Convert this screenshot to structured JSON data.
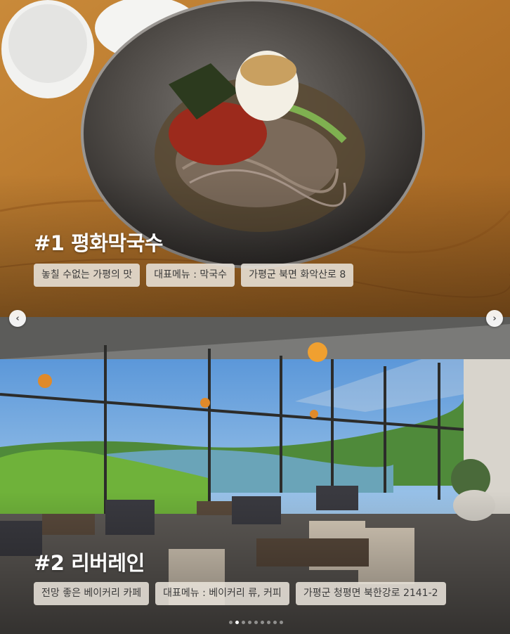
{
  "cards": [
    {
      "title": "#1 평화막국수",
      "tags": [
        "놓칠 수없는 가평의 맛",
        "대표메뉴 : 막국수",
        "가평군 북면 화악산로 8"
      ],
      "image_icon": "buckwheat-noodle-photo"
    },
    {
      "title": "#2 리버레인",
      "tags": [
        "전망 좋은 베이커리 카페",
        "대표메뉴 : 베이커리 류, 커피",
        "가평군 청평면 북한강로 2141-2"
      ],
      "image_icon": "river-view-cafe-photo"
    }
  ],
  "carousel": {
    "prev_icon": "chevron-left-icon",
    "next_icon": "chevron-right-icon",
    "prev_glyph": "‹",
    "next_glyph": "›",
    "page_count": 9,
    "active_page": 1
  },
  "colors": {
    "tag_background": "#e8e2da",
    "tag_text": "#3a3a3a",
    "title_text": "#ffffff"
  }
}
